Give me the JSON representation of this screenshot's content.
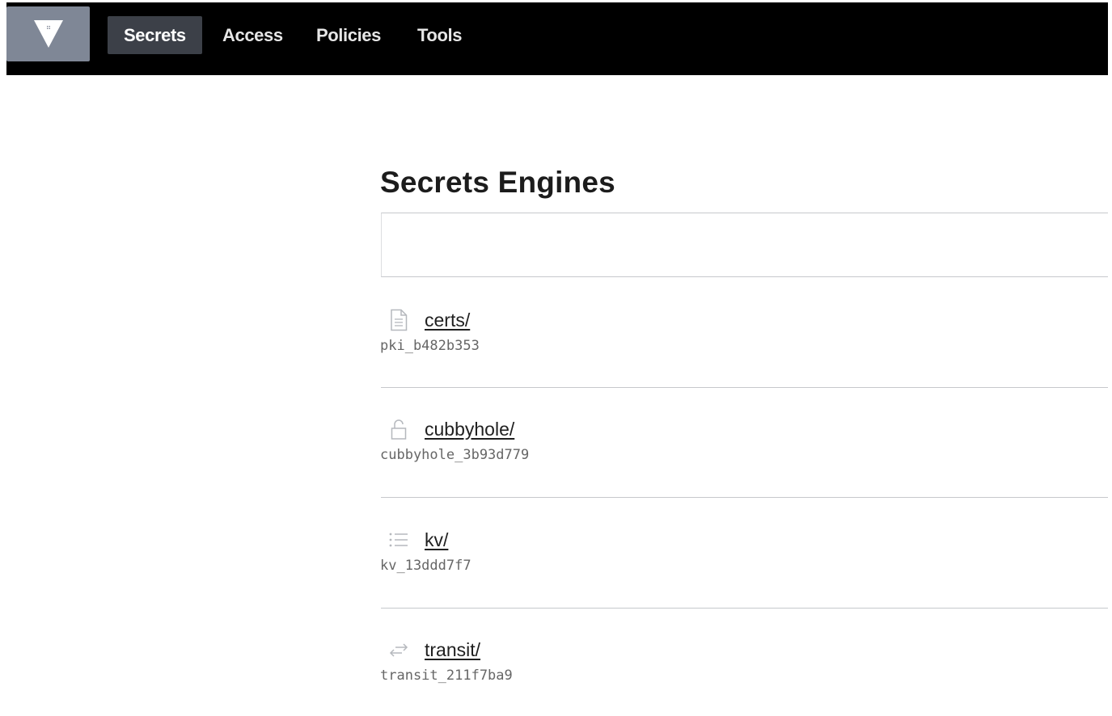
{
  "nav": {
    "logo_icon": "vault-logo-icon",
    "items": [
      {
        "label": "Secrets",
        "active": true
      },
      {
        "label": "Access",
        "active": false
      },
      {
        "label": "Policies",
        "active": false
      },
      {
        "label": "Tools",
        "active": false
      }
    ]
  },
  "page": {
    "title": "Secrets Engines"
  },
  "engines": [
    {
      "path": "certs/",
      "accessor": "pki_b482b353",
      "icon": "file-icon"
    },
    {
      "path": "cubbyhole/",
      "accessor": "cubbyhole_3b93d779",
      "icon": "lock-icon"
    },
    {
      "path": "kv/",
      "accessor": "kv_13ddd7f7",
      "icon": "list-icon"
    },
    {
      "path": "transit/",
      "accessor": "transit_211f7ba9",
      "icon": "swap-icon"
    }
  ],
  "colors": {
    "nav_background": "#000000",
    "nav_active": "#3c4048",
    "logo_background": "#7f8796"
  }
}
